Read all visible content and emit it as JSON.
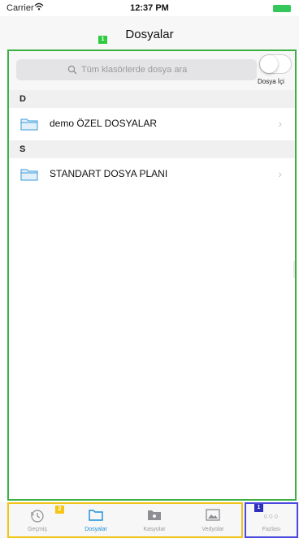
{
  "status_bar": {
    "carrier": "Carrier",
    "wifi_icon": "wifi-icon",
    "time": "12:37 PM",
    "battery_color": "#34c759"
  },
  "nav": {
    "title": "Dosyalar"
  },
  "markers": {
    "content": "1",
    "tabs": "2",
    "more": "1"
  },
  "search": {
    "placeholder": "Tüm klasörlerde dosya ara",
    "toggle_label": "Dosya İçi",
    "toggle_on": false
  },
  "sections": [
    {
      "letter": "D",
      "items": [
        {
          "label": "demo ÖZEL DOSYALAR",
          "icon": "folder-icon"
        }
      ]
    },
    {
      "letter": "S",
      "items": [
        {
          "label": "STANDART DOSYA PLANI",
          "icon": "folder-icon"
        }
      ]
    }
  ],
  "tabs": [
    {
      "label": "Geçmiş",
      "icon": "history-clock-icon",
      "active": false
    },
    {
      "label": "Dosyalar",
      "icon": "folder-icon",
      "active": true
    },
    {
      "label": "Kasyolar",
      "icon": "camera-folder-icon",
      "active": false
    },
    {
      "label": "Vedyolar",
      "icon": "photo-gallery-icon",
      "active": false
    }
  ],
  "more_tab": {
    "label": "Fazlası",
    "icon": "more-dots-icon",
    "dots": "○○○"
  },
  "colors": {
    "accent": "#1a8fd6",
    "content_border": "#3cb043",
    "tab_group_border": "#f0c419",
    "more_border": "#4a4adf"
  }
}
